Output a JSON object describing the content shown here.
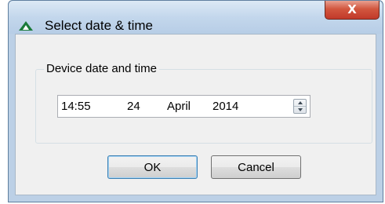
{
  "window": {
    "title": "Select date & time",
    "close_label": "X"
  },
  "group": {
    "label": "Device date and time"
  },
  "datetime": {
    "time": "14:55",
    "day": "24",
    "month": "April",
    "year": "2014"
  },
  "buttons": {
    "ok_label": "OK",
    "cancel_label": "Cancel"
  },
  "icons": {
    "app": "triangle-logo-icon",
    "close": "close-icon",
    "spin_up": "chevron-up-icon",
    "spin_down": "chevron-down-icon"
  },
  "colors": {
    "app_icon": "#1a7a3a",
    "close_button": "#c1392a",
    "window_frame": "#bcd0e6",
    "dialog_background": "#f0f0f0",
    "default_button_border": "#3c7fb1"
  }
}
